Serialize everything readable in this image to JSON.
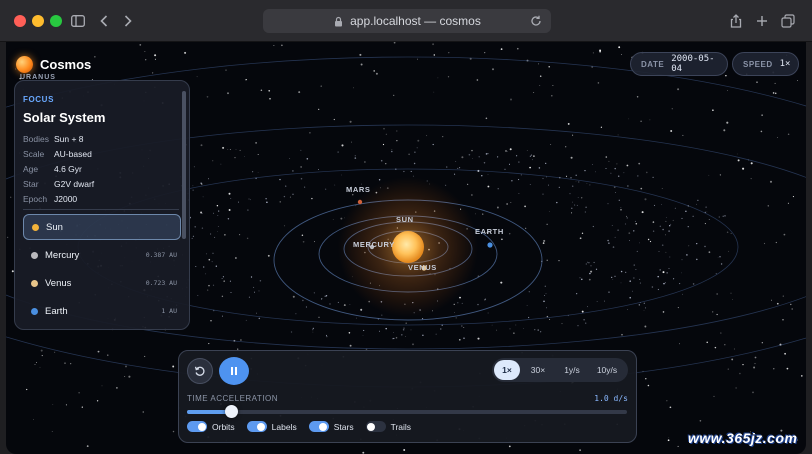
{
  "browser": {
    "url": "app.localhost — cosmos"
  },
  "brand": {
    "name": "Cosmos",
    "cut_label": "URANUS"
  },
  "header": {
    "date_label": "DATE",
    "date_value": "2000-05-04",
    "speed_label": "SPEED",
    "speed_value": "1×"
  },
  "focus": {
    "kicker": "FOCUS",
    "title": "Solar System",
    "stats": [
      {
        "key": "Bodies",
        "value": "Sun + 8"
      },
      {
        "key": "Scale",
        "value": "AU-based"
      },
      {
        "key": "Age",
        "value": "4.6 Gyr"
      },
      {
        "key": "Star",
        "value": "G2V dwarf"
      },
      {
        "key": "Epoch",
        "value": "J2000"
      }
    ],
    "bodies": [
      {
        "name": "Sun",
        "distance": "",
        "color": "#f2b23a",
        "active": true
      },
      {
        "name": "Mercury",
        "distance": "0.387 AU",
        "color": "#b9b9bd",
        "active": false
      },
      {
        "name": "Venus",
        "distance": "0.723 AU",
        "color": "#e8c58a",
        "active": false
      },
      {
        "name": "Earth",
        "distance": "1 AU",
        "color": "#4a8fe0",
        "active": false
      }
    ]
  },
  "scene": {
    "labels": {
      "sun": "SUN",
      "mercury": "MERCURY",
      "venus": "VENUS",
      "earth": "EARTH",
      "mars": "MARS"
    }
  },
  "controls": {
    "reset_icon": "reset-icon",
    "pause_icon": "pause-icon",
    "speeds": [
      "1×",
      "30×",
      "1y/s",
      "10y/s"
    ],
    "active_speed": "1×",
    "time_acceleration_label": "TIME ACCELERATION",
    "time_acceleration_value": "1.0 d/s",
    "slider_fraction": 0.1,
    "toggles": [
      {
        "label": "Orbits",
        "on": true
      },
      {
        "label": "Labels",
        "on": true
      },
      {
        "label": "Stars",
        "on": true
      },
      {
        "label": "Trails",
        "on": false
      }
    ]
  },
  "watermark": "www.365jz.com",
  "colors": {
    "accent": "#4e93f0",
    "sun": "#f2b23a",
    "panel": "#181c26"
  }
}
